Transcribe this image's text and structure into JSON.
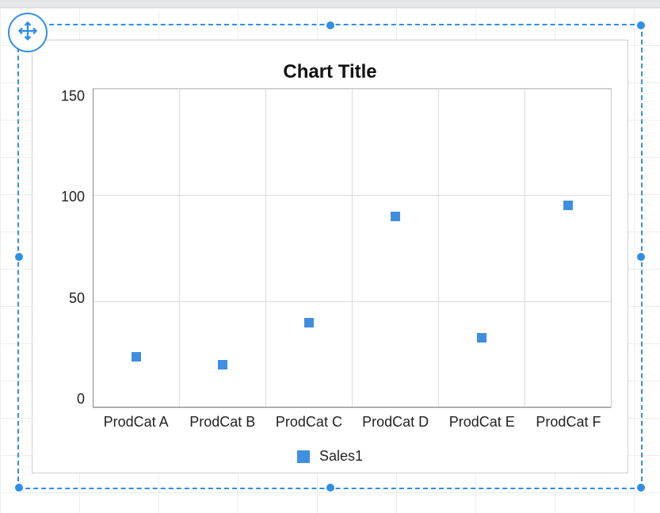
{
  "chart_data": {
    "type": "scatter",
    "title": "Chart Title",
    "categories": [
      "ProdCat A",
      "ProdCat B",
      "ProdCat C",
      "ProdCat D",
      "ProdCat E",
      "ProdCat F"
    ],
    "series": [
      {
        "name": "Sales1",
        "values": [
          24,
          20,
          40,
          90,
          33,
          95
        ]
      }
    ],
    "ylim": [
      0,
      150
    ],
    "y_ticks": [
      0,
      50,
      100,
      150
    ],
    "xlabel": "",
    "ylabel": ""
  },
  "colors": {
    "accent": "#2f8fe6",
    "series1": "#3f8fe0"
  }
}
